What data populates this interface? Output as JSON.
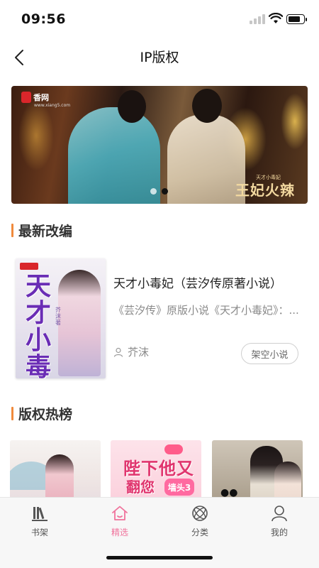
{
  "status_bar": {
    "time": "09:56"
  },
  "nav": {
    "title": "IP版权"
  },
  "banner": {
    "logo_text": "香网",
    "logo_sub": "www.xiang5.com",
    "stamp_title": "王妃火辣",
    "stamp_small": "天才小毒妃",
    "slide_count": 2,
    "active_slide": 2
  },
  "sections": {
    "latest": "最新改编",
    "hot": "版权热榜"
  },
  "latest_book": {
    "title": "天才小毒妃（芸汐传原著小说）",
    "description": "《芸汐传》原版小说《天才小毒妃》：...",
    "author": "芥沫",
    "tag": "架空小说",
    "cover_title": "天才小毒妃",
    "cover_author": "芥沫著"
  },
  "hot_covers": [
    {
      "id": "hot-1"
    },
    {
      "id": "hot-2",
      "line1": "陛下他又",
      "line2": "翻您",
      "badge": "墙头3"
    },
    {
      "id": "hot-3",
      "mark": "●●"
    }
  ],
  "tabs": [
    {
      "label": "书架",
      "icon": "bookshelf-icon",
      "active": false
    },
    {
      "label": "精选",
      "icon": "home-icon",
      "active": true
    },
    {
      "label": "分类",
      "icon": "category-icon",
      "active": false
    },
    {
      "label": "我的",
      "icon": "profile-icon",
      "active": false
    }
  ],
  "colors": {
    "accent": "#f0739c",
    "section_bar": "#f08a3c",
    "text_muted": "#8a8a8a"
  }
}
